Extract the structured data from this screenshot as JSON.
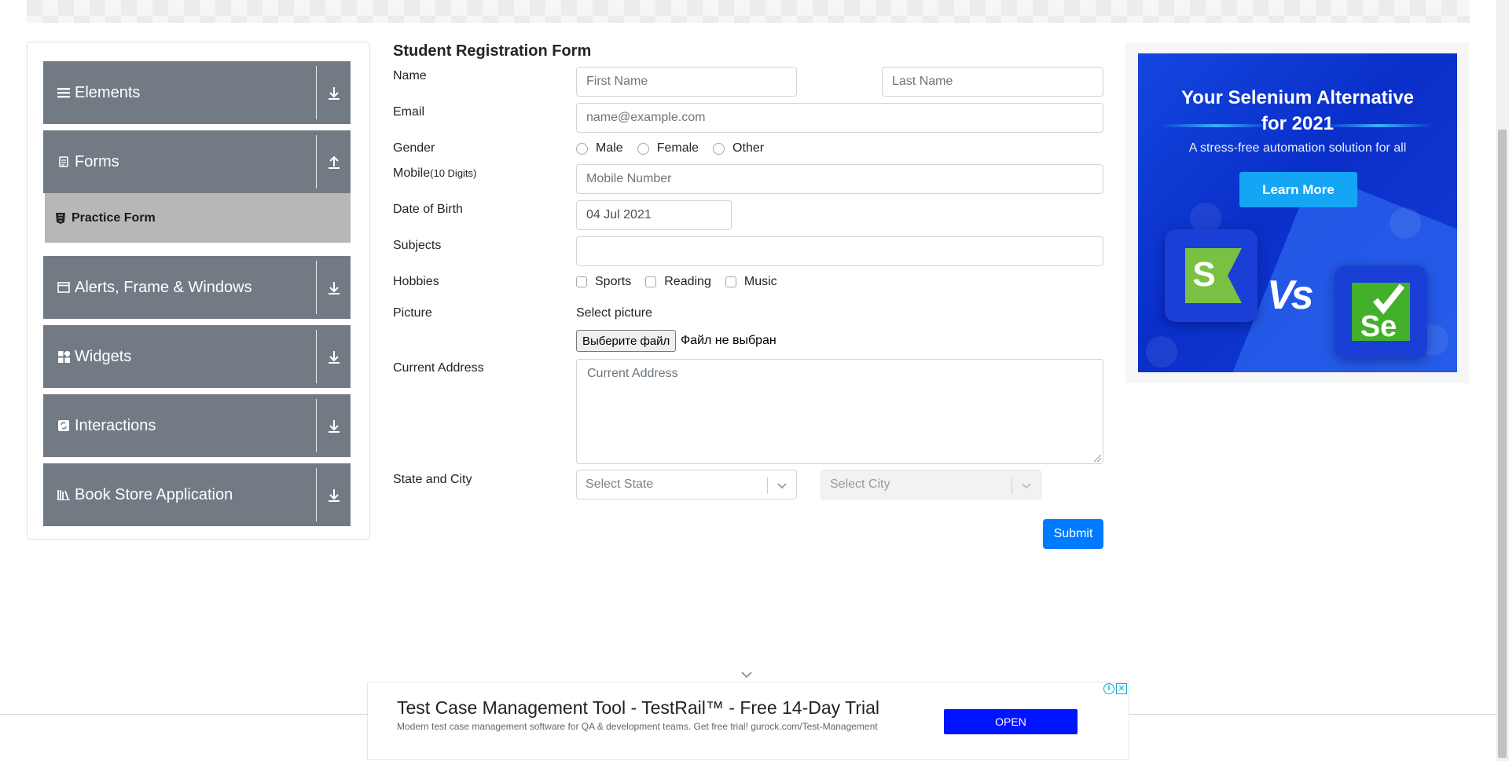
{
  "sidebar": {
    "groups": [
      {
        "label": "Elements",
        "icon": "hamburger-icon",
        "toggle": "download-icon"
      },
      {
        "label": "Forms",
        "icon": "document-icon",
        "toggle": "upload-icon"
      },
      {
        "label": "Alerts, Frame & Windows",
        "icon": "window-icon",
        "toggle": "download-icon"
      },
      {
        "label": "Widgets",
        "icon": "widgets-grid-icon",
        "toggle": "download-icon"
      },
      {
        "label": "Interactions",
        "icon": "interactions-icon",
        "toggle": "download-icon"
      },
      {
        "label": "Book Store Application",
        "icon": "books-icon",
        "toggle": "download-icon"
      }
    ],
    "active_item": {
      "label": "Practice Form",
      "icon": "html5-icon"
    }
  },
  "form": {
    "title": "Student Registration Form",
    "name_label": "Name",
    "first_name_placeholder": "First Name",
    "last_name_placeholder": "Last Name",
    "email_label": "Email",
    "email_placeholder": "name@example.com",
    "gender_label": "Gender",
    "gender_options": [
      "Male",
      "Female",
      "Other"
    ],
    "mobile_label": "Mobile",
    "mobile_hint": "(10 Digits)",
    "mobile_placeholder": "Mobile Number",
    "dob_label": "Date of Birth",
    "dob_value": "04 Jul 2021",
    "subjects_label": "Subjects",
    "hobbies_label": "Hobbies",
    "hobbies_options": [
      "Sports",
      "Reading",
      "Music"
    ],
    "picture_label": "Picture",
    "select_picture_label": "Select picture",
    "file_button_label": "Выберите файл",
    "file_status": "Файл не выбран",
    "address_label": "Current Address",
    "address_placeholder": "Current Address",
    "state_city_label": "State and City",
    "state_placeholder": "Select State",
    "city_placeholder": "Select City",
    "submit_label": "Submit"
  },
  "right_ad": {
    "title_line1": "Your Selenium Alternative",
    "title_line2": "for 2021",
    "subtitle": "A stress-free automation solution for all",
    "button_label": "Learn More",
    "vs_text": "Vs",
    "left_logo_text": "S",
    "right_logo_text": "Se",
    "colors": {
      "background": "#1446e0",
      "button": "#14a5f5",
      "left_logo": "#7ac143",
      "right_logo": "#43b02a"
    }
  },
  "bottom_ad": {
    "headline": "Test Case Management Tool - TestRail™ - Free 14-Day Trial",
    "body": "Modern test case management software for QA & development teams. Get free trial! gurock.com/Test-Management",
    "open_label": "OPEN",
    "info_glyph": "i",
    "close_glyph": "✕"
  },
  "colors": {
    "sidebar_group_bg": "#727b84",
    "active_item_bg": "#b7b7b7",
    "submit_bg": "#007bff",
    "ad_open_bg": "#0014ff"
  }
}
